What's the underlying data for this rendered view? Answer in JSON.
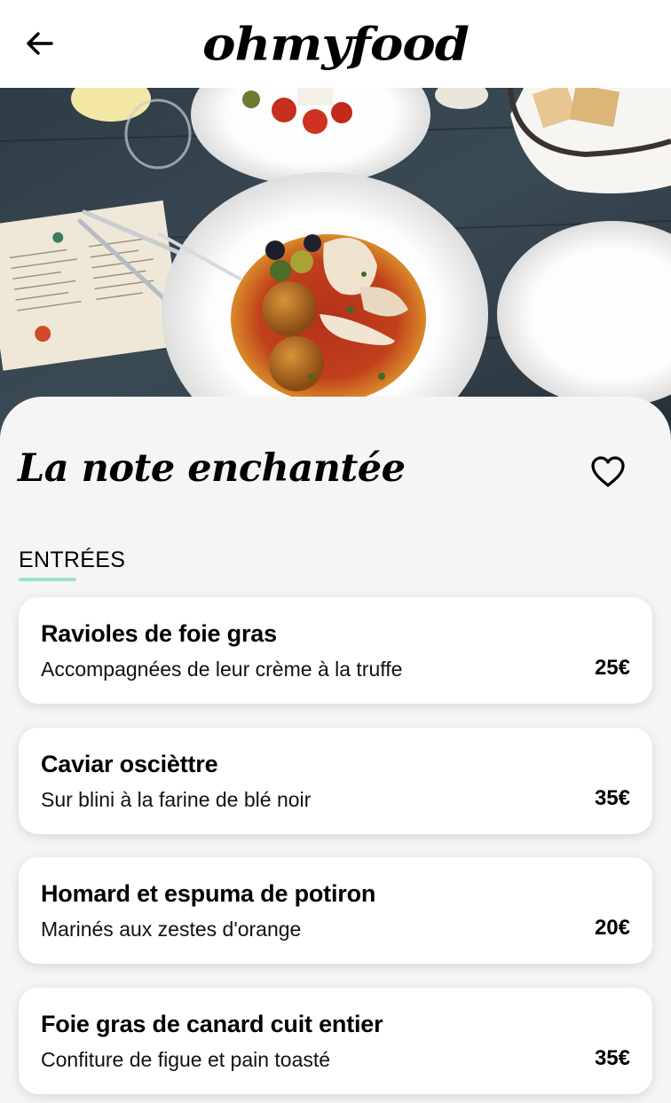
{
  "header": {
    "logo_text": "ohmyfood",
    "back_icon": "arrow-left-icon"
  },
  "restaurant": {
    "name": "La note enchantée",
    "favorite_icon": "heart-outline-icon"
  },
  "menu": {
    "section_title": "ENTRÉES",
    "accent_color": "#99e2d0",
    "items": [
      {
        "name": "Ravioles de foie gras",
        "description": "Accompagnées de leur crème à la truffe",
        "price": "25€"
      },
      {
        "name": "Caviar oscièttre",
        "description": "Sur blini à la farine de blé noir",
        "price": "35€"
      },
      {
        "name": "Homard et espuma de potiron",
        "description": "Marinés aux zestes d'orange",
        "price": "20€"
      },
      {
        "name": "Foie gras de canard cuit entier",
        "description": "Confiture de figue et pain toasté",
        "price": "35€"
      }
    ]
  }
}
